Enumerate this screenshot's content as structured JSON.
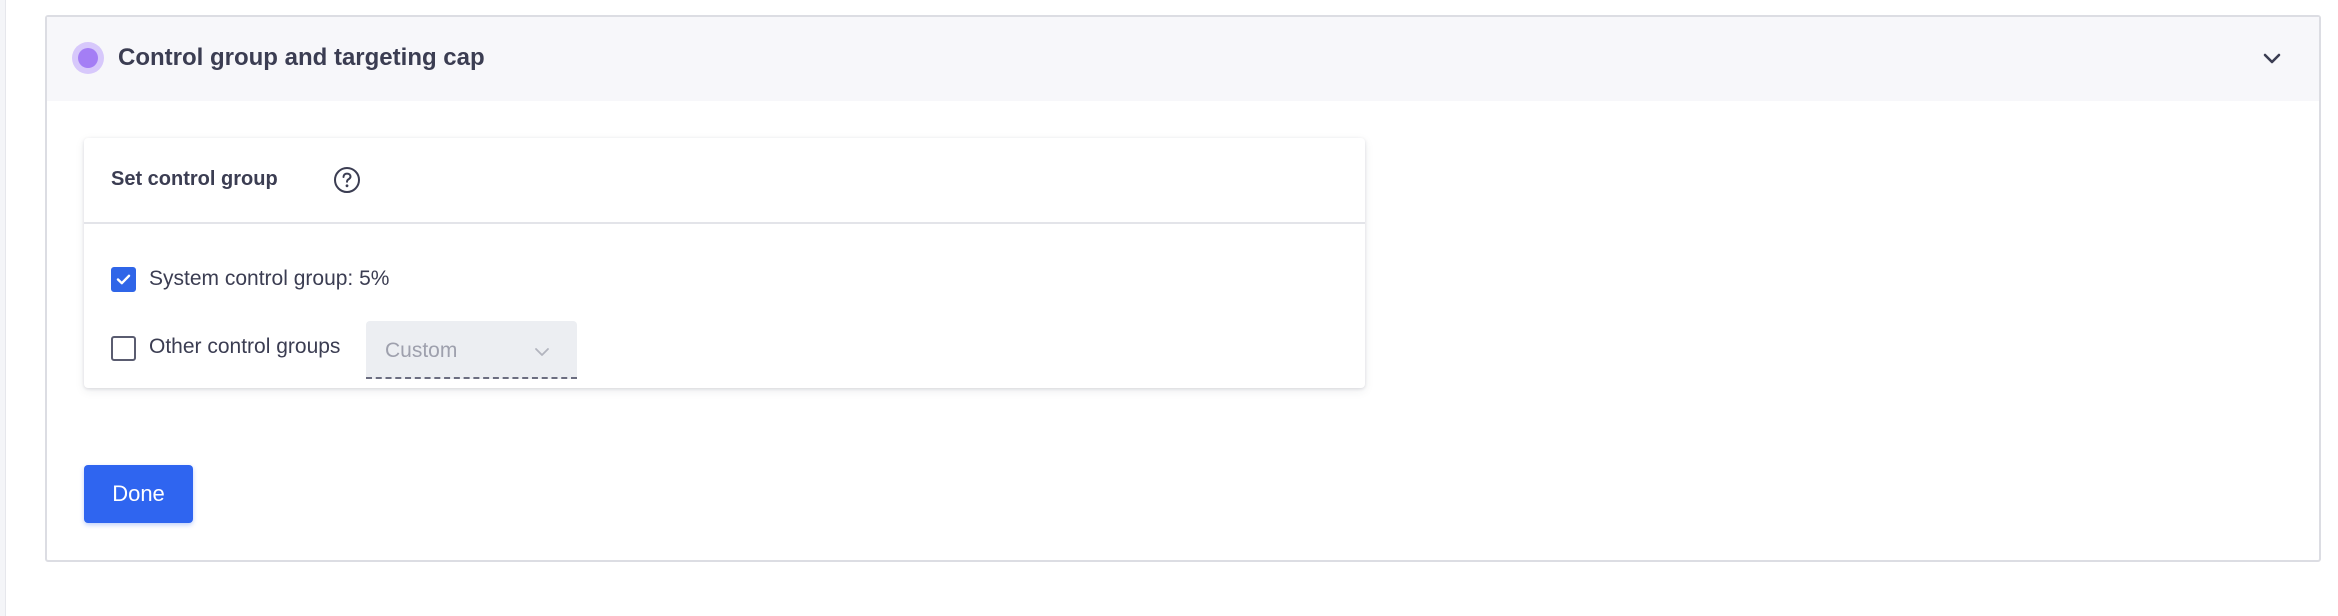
{
  "panel": {
    "title": "Control group and targeting cap",
    "status_color": "#a47ef5",
    "collapse_icon": "chevron-down-icon"
  },
  "card": {
    "title": "Set control group",
    "help_icon": "question-circle-icon",
    "options": [
      {
        "label": "System control group: 5%",
        "checked": true
      },
      {
        "label": "Other control groups",
        "checked": false
      }
    ],
    "select": {
      "value": "Custom",
      "disabled": true
    }
  },
  "actions": {
    "done_label": "Done"
  },
  "colors": {
    "accent": "#2f65f0",
    "text": "#3b3d52",
    "header_bg": "#f7f7fa"
  }
}
